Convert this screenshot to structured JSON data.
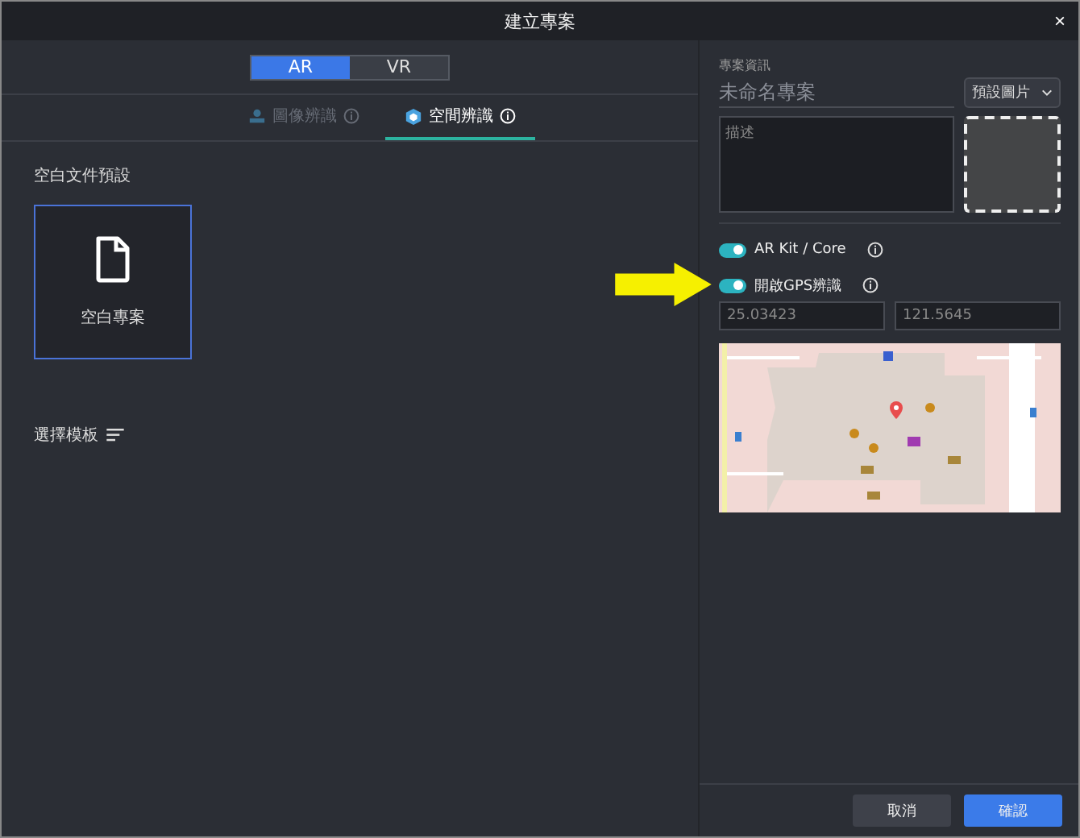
{
  "window": {
    "title": "建立專案",
    "close": "×"
  },
  "mode_toggle": [
    {
      "label": "AR",
      "selected": true
    },
    {
      "label": "VR",
      "selected": false
    }
  ],
  "recognition_tabs": [
    {
      "label": "圖像辨識",
      "selected": false
    },
    {
      "label": "空間辨識",
      "selected": true
    }
  ],
  "blank_section": {
    "heading": "空白文件預設",
    "cards": [
      {
        "label": "空白專案",
        "selected": true
      }
    ]
  },
  "template_section": {
    "heading": "選擇模板"
  },
  "project_info": {
    "heading": "專案資訊",
    "name_placeholder": "未命名專案",
    "image_dropdown": "預設圖片",
    "description_placeholder": "描述"
  },
  "toggles": [
    {
      "label": "AR Kit / Core",
      "on": true
    },
    {
      "label": "開啟GPS辨識",
      "on": true
    }
  ],
  "coordinates": [
    {
      "value": "25.03423"
    },
    {
      "value": "121.5645"
    }
  ],
  "buttons": [
    {
      "label": "取消",
      "kind": "secondary"
    },
    {
      "label": "確認",
      "kind": "primary"
    }
  ]
}
